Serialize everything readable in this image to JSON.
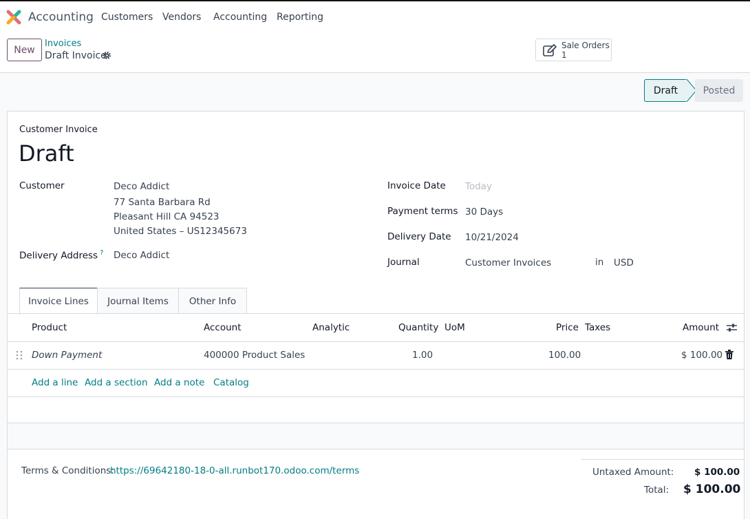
{
  "app": {
    "name": "Accounting"
  },
  "nav": {
    "items": [
      "Customers",
      "Vendors",
      "Accounting",
      "Reporting"
    ]
  },
  "control": {
    "new_label": "New",
    "breadcrumb_parent": "Invoices",
    "breadcrumb_current": "Draft Invoice",
    "smart_button": {
      "label": "Sale Orders",
      "value": "1"
    }
  },
  "status": {
    "current": "Draft",
    "next": "Posted"
  },
  "invoice": {
    "type_label": "Customer Invoice",
    "title": "Draft",
    "customer_label": "Customer",
    "customer_name": "Deco Addict",
    "address_lines": [
      "77 Santa Barbara Rd",
      "Pleasant Hill CA 94523",
      "United States – US12345673"
    ],
    "delivery_address_label": "Delivery Address",
    "delivery_address_help": "?",
    "delivery_address_value": "Deco Addict",
    "invoice_date_label": "Invoice Date",
    "invoice_date_placeholder": "Today",
    "payment_terms_label": "Payment terms",
    "payment_terms_value": "30 Days",
    "delivery_date_label": "Delivery Date",
    "delivery_date_value": "10/21/2024",
    "journal_label": "Journal",
    "journal_value": "Customer Invoices",
    "journal_in": "in",
    "currency": "USD"
  },
  "tabs": [
    "Invoice Lines",
    "Journal Items",
    "Other Info"
  ],
  "lines": {
    "headers": {
      "product": "Product",
      "account": "Account",
      "analytic": "Analytic",
      "quantity": "Quantity",
      "uom": "UoM",
      "price": "Price",
      "taxes": "Taxes",
      "amount": "Amount"
    },
    "rows": [
      {
        "product": "Down Payment",
        "account": "400000 Product Sales",
        "quantity": "1.00",
        "price": "100.00",
        "amount": "$ 100.00"
      }
    ],
    "actions": [
      "Add a line",
      "Add a section",
      "Add a note",
      "Catalog"
    ]
  },
  "footer": {
    "terms_label": "Terms & Conditions:",
    "terms_link": "https://69642180-18-0-all.runbot170.odoo.com/terms",
    "untaxed_label": "Untaxed Amount:",
    "untaxed_value": "$ 100.00",
    "total_label": "Total:",
    "total_value": "$ 100.00"
  },
  "colors": {
    "brand": "#714b67",
    "link": "#017e84"
  },
  "icons": [
    "app-logo-icon",
    "gear-icon",
    "edit-icon",
    "drag-handle-icon",
    "trash-icon",
    "column-settings-icon"
  ]
}
